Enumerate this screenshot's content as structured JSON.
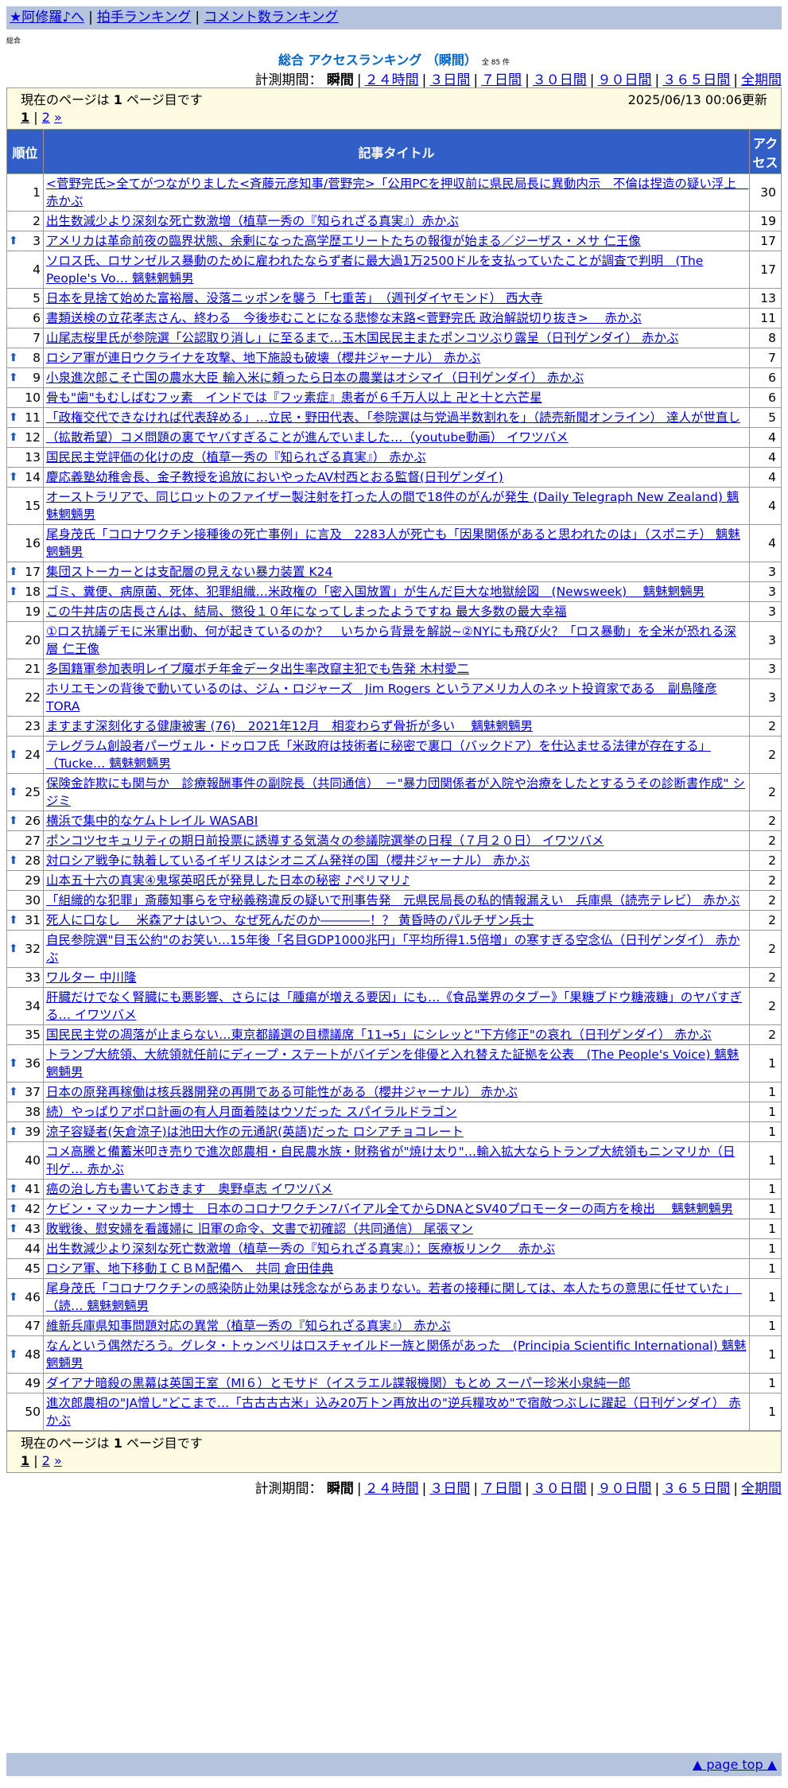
{
  "top_links": [
    "★阿修羅♪へ",
    "拍手ランキング",
    "コメント数ランキング"
  ],
  "small_label": "総合",
  "title": "総合 アクセスランキング （瞬間）",
  "count_label": "全 85 件",
  "period_label": "計測期間：",
  "period_current": "瞬間",
  "period_links": [
    "２４時間",
    "３日間",
    "７日間",
    "３０日間",
    "９０日間",
    "３６５日間",
    "全期間"
  ],
  "page_info_prefix": "現在のページは",
  "page_info_num": "1",
  "page_info_suffix": "ページ目です",
  "updated": "2025/06/13 00:06更新",
  "pager": {
    "current": "1",
    "next": "2",
    "next_arrow": "»"
  },
  "headers": {
    "rank": "順位",
    "title": "記事タイトル",
    "access": "アクセス"
  },
  "rows": [
    {
      "rank": "1",
      "up": false,
      "title": "<菅野完氏>全てがつながりました<斉藤元彦知事/菅野完>「公用PCを押収前に県民局長に異動内示　不倫は捏造の疑い浮上　赤かぶ",
      "count": "30"
    },
    {
      "rank": "2",
      "up": false,
      "title": "出生数減少より深刻な死亡数激増（植草一秀の『知られざる真実』）赤かぶ",
      "count": "19"
    },
    {
      "rank": "3",
      "up": true,
      "title": "アメリカは革命前夜の臨界状態、余剰になった高学歴エリートたちの報復が始まる／ジーザス・メサ 仁王像",
      "count": "17"
    },
    {
      "rank": "4",
      "up": false,
      "title": "ソロス氏、ロサンゼルス暴動のために雇われたならず者に最大過1万2500ドルを支払っていたことが調査で判明　(The People's Vo…  魑魅魍魎男",
      "count": "17"
    },
    {
      "rank": "5",
      "up": false,
      "title": "日本を見捨て始めた富裕層、没落ニッポンを襲う「七重苦」　（週刊ダイヤモンド） 西大寺",
      "count": "13"
    },
    {
      "rank": "6",
      "up": false,
      "title": "書類送検の立花孝志さん、終わる　今後歩むことになる悲惨な末路<菅野完氏 政治解説切り抜き>　 赤かぶ",
      "count": "11"
    },
    {
      "rank": "7",
      "up": false,
      "title": "山尾志桜里氏が参院選「公認取り消し」に至るまで…玉木国民民主またポンコツぶり露呈（日刊ゲンダイ） 赤かぶ",
      "count": "8"
    },
    {
      "rank": "8",
      "up": true,
      "title": "ロシア軍が連日ウクライナを攻撃、地下施設も破壊（櫻井ジャーナル） 赤かぶ",
      "count": "7"
    },
    {
      "rank": "9",
      "up": true,
      "title": "小泉進次郎こそ亡国の農水大臣 輸入米に頼ったら日本の農業はオシマイ（日刊ゲンダイ） 赤かぶ",
      "count": "6"
    },
    {
      "rank": "10",
      "up": false,
      "title": "骨も\"歯\"もむしばむフッ素　インドでは『フッ素症』患者が６千万人以上 卍と十と六芒星",
      "count": "6"
    },
    {
      "rank": "11",
      "up": true,
      "title": "「政権交代できなければ代表辞める」…立民・野田代表、「参院選は与党過半数割れを」（読売新聞オンライン） 達人が世直し",
      "count": "5"
    },
    {
      "rank": "12",
      "up": true,
      "title": "（拡散希望）コメ問題の裏でヤバすぎることが進んでいました…（youtube動画） イワツバメ",
      "count": "4"
    },
    {
      "rank": "13",
      "up": false,
      "title": "国民民主党評価の化けの皮（植草一秀の『知られざる真実』） 赤かぶ",
      "count": "4"
    },
    {
      "rank": "14",
      "up": true,
      "title": "慶応義塾幼稚舎長、金子教授を追放においやったAV村西とおる監督(日刊ゲンダイ)",
      "count": "4"
    },
    {
      "rank": "15",
      "up": false,
      "title": "オーストラリアで、同じロットのファイザー製注射を打った人の間で18件のがんが発生 (Daily Telegraph New Zealand) 魑魅魍魎男",
      "count": "4"
    },
    {
      "rank": "16",
      "up": false,
      "title": "尾身茂氏「コロナワクチン接種後の死亡事例」に言及　2283人が死亡も「因果関係があると思われたのは」（スポニチ） 魑魅魍魎男",
      "count": "4"
    },
    {
      "rank": "17",
      "up": true,
      "title": "集団ストーカーとは支配層の見えない暴力装置 K24",
      "count": "3"
    },
    {
      "rank": "18",
      "up": true,
      "title": "ゴミ、糞便、病原菌、死体、犯罪組織…米政権の「密入国放置」が生んだ巨大な地獄絵図　(Newsweek)　 魑魅魍魎男",
      "count": "3"
    },
    {
      "rank": "19",
      "up": false,
      "title": "この牛丼店の店長さんは、結局、懲役１０年になってしまったようですね 最大多数の最大幸福",
      "count": "3"
    },
    {
      "rank": "20",
      "up": false,
      "title": "①ロス抗議デモに米軍出動、何が起きているのか？　いちから背景を解説~②NYにも飛び火？「ロス暴動」を全米が恐れる深層 仁王像",
      "count": "3"
    },
    {
      "rank": "21",
      "up": false,
      "title": "多国籍軍参加表明レイプ魔ボチ年金データ出生率改竄主犯でも告発 木村愛二",
      "count": "3"
    },
    {
      "rank": "22",
      "up": false,
      "title": "ホリエモンの背後で動いているのは、ジム・ロジャーズ　Jim Rogers というアメリカ人のネット投資家である　副島隆彦 TORA",
      "count": "3"
    },
    {
      "rank": "23",
      "up": false,
      "title": "ますます深刻化する健康被害 (76)　2021年12月　相変わらず骨折が多い　 魑魅魍魎男",
      "count": "2"
    },
    {
      "rank": "24",
      "up": true,
      "title": "テレグラム創設者パーヴェル・ドゥロフ氏「米政府は技術者に秘密で裏口（バックドア）を仕込ませる法律が存在する」（Tucke… 魑魅魍魎男",
      "count": "2"
    },
    {
      "rank": "25",
      "up": true,
      "title": "保険金詐欺にも関与か　診療報酬事件の副院長（共同通信）　－\"暴力団関係者が入院や治療をしたとするうその診断書作成\" シジミ",
      "count": "2"
    },
    {
      "rank": "26",
      "up": true,
      "title": "横浜で集中的なケムトレイル WASABI",
      "count": "2"
    },
    {
      "rank": "27",
      "up": false,
      "title": "ポンコツセキュリティの期日前投票に誘導する気満々の参議院選挙の日程（７月２０日） イワツバメ",
      "count": "2"
    },
    {
      "rank": "28",
      "up": true,
      "title": "対ロシア戦争に執着しているイギリスはシオニズム発祥の国（櫻井ジャーナル） 赤かぶ",
      "count": "2"
    },
    {
      "rank": "29",
      "up": false,
      "title": "山本五十六の真実④鬼塚英昭氏が発見した日本の秘密 ♪ペリマリ♪",
      "count": "2"
    },
    {
      "rank": "30",
      "up": false,
      "title": "「組織的な犯罪」斎藤知事らを守秘義務違反の疑いで刑事告発　元県民局長の私的情報漏えい　兵庫県（読売テレビ） 赤かぶ",
      "count": "2"
    },
    {
      "rank": "31",
      "up": true,
      "title": "死人に口なし　 米森アナはいつ、なぜ死んだのか――――！？ 黄昏時のパルチザン兵士",
      "count": "2"
    },
    {
      "rank": "32",
      "up": true,
      "title": "自民参院選\"目玉公約\"のお笑い…15年後「名目GDP1000兆円」「平均所得1.5倍増」の寒すぎる空念仏（日刊ゲンダイ） 赤かぶ",
      "count": "2"
    },
    {
      "rank": "33",
      "up": false,
      "title": "ワルター 中川隆",
      "count": "2"
    },
    {
      "rank": "34",
      "up": false,
      "title": "肝臓だけでなく腎臓にも悪影響、さらには「腫瘍が増える要因」にも…《食品業界のタブー》「果糖ブドウ糖液糖」のヤバすぎる… イワツバメ",
      "count": "2"
    },
    {
      "rank": "35",
      "up": false,
      "title": "国民民主党の凋落が止まらない…東京都議選の目標議席「11→5」にシレッと\"下方修正\"の哀れ（日刊ゲンダイ） 赤かぶ",
      "count": "2"
    },
    {
      "rank": "36",
      "up": true,
      "title": "トランプ大統領、大統領就任前にディープ・ステートがバイデンを俳優と入れ替えた証拠を公表　(The People's Voice) 魑魅魍魎男",
      "count": "1"
    },
    {
      "rank": "37",
      "up": true,
      "title": "日本の原発再稼働は核兵器開発の再開である可能性がある（櫻井ジャーナル） 赤かぶ",
      "count": "1"
    },
    {
      "rank": "38",
      "up": false,
      "title": "続）やっぱりアポロ計画の有人月面着陸はウソだった スパイラルドラゴン",
      "count": "1"
    },
    {
      "rank": "39",
      "up": true,
      "title": "涼子容疑者(矢倉涼子)は池田大作の元通訳(英語)だった ロシアチョコレート",
      "count": "1"
    },
    {
      "rank": "40",
      "up": false,
      "title": "コメ高騰と備蓄米叩き売りで進次郎農相・自民農水族・財務省が\"焼け太り\"…輸入拡大ならトランプ大統領もニンマリか（日刊ゲ… 赤かぶ",
      "count": "1"
    },
    {
      "rank": "41",
      "up": true,
      "title": "癌の治し方も書いておきます　奥野卓志 イワツバメ",
      "count": "1"
    },
    {
      "rank": "42",
      "up": true,
      "title": "ケビン・マッカーナン博士　日本のコロナワクチン7バイアル全てからDNAとSV40プロモーターの両方を検出　 魑魅魍魎男",
      "count": "1"
    },
    {
      "rank": "43",
      "up": true,
      "title": "敗戦後、慰安婦を看護婦に 旧軍の命令、文書で初確認（共同通信） 尾張マン",
      "count": "1"
    },
    {
      "rank": "44",
      "up": false,
      "title": "出生数減少より深刻な死亡数激増（植草一秀の『知られざる真実』）：医療板リンク　 赤かぶ",
      "count": "1"
    },
    {
      "rank": "45",
      "up": false,
      "title": "ロシア軍、地下移動ＩＣＢＭ配備へ　共同 倉田佳典",
      "count": "1"
    },
    {
      "rank": "46",
      "up": true,
      "title": "尾身茂氏「コロナワクチンの感染防止効果は残念ながらあまりない。若者の接種に関しては、本人たちの意思に任せていた」　（読… 魑魅魍魎男",
      "count": "1"
    },
    {
      "rank": "47",
      "up": false,
      "title": "維新兵庫県知事問題対応の異常（植草一秀の『知られざる真実』） 赤かぶ",
      "count": "1"
    },
    {
      "rank": "48",
      "up": true,
      "title": "なんという偶然だろう。グレタ・トゥンベリはロスチャイルド一族と関係があった　(Principia Scientific International) 魑魅魍魎男",
      "count": "1"
    },
    {
      "rank": "49",
      "up": false,
      "title": "ダイアナ暗殺の黒幕は英国王室（MI６）とモサド（イスラエル諜報機関）もとめ スーパー珍米小泉純一郎",
      "count": "1"
    },
    {
      "rank": "50",
      "up": false,
      "title": "進次郎農相の\"JA憎し\"どこまで…「古古古古米」込み20万トン再放出の\"逆兵糧攻め\"で宿敵つぶしに躍起（日刊ゲンダイ） 赤かぶ",
      "count": "1"
    }
  ],
  "page_top": "▲ page top ▲"
}
